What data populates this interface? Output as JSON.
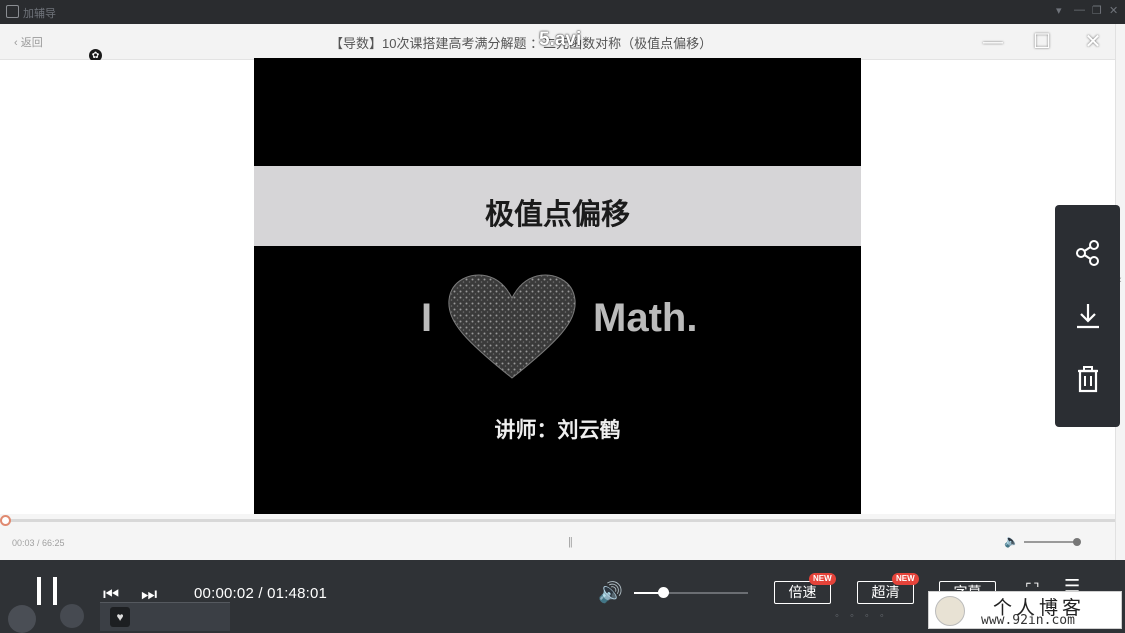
{
  "app": {
    "name": "加辅导",
    "back_label": "返回",
    "video_title": "【导数】10次课搭建高考满分解题  ：二元函数对称（极值点偏移）",
    "file_name": "5.avi"
  },
  "video_frame": {
    "band_title": "极值点偏移",
    "i_letter": "I",
    "math_text": "Math.",
    "lecturer": "讲师：刘云鹤"
  },
  "mini_bar": {
    "time": "00:03 / 66:25",
    "pause_glyph": "||"
  },
  "controls": {
    "current_time": "00:00:02",
    "separator": " / ",
    "total_time": "01:48:01",
    "speed_label": "倍速",
    "speed_badge": "NEW",
    "quality_label": "超清",
    "quality_badge": "NEW",
    "subtitle_label": "字幕",
    "volume_level": 0.25,
    "progress": 0.0
  },
  "side_panel": {
    "icons": [
      "share-icon",
      "download-icon",
      "delete-icon"
    ]
  },
  "watermark": {
    "title": "个人博客",
    "url": "www.92in.com"
  },
  "colors": {
    "control_bar": "#2f3236",
    "side_panel": "#2b2e33",
    "badge": "#e5433a",
    "progress_knob": "#e08a70"
  }
}
